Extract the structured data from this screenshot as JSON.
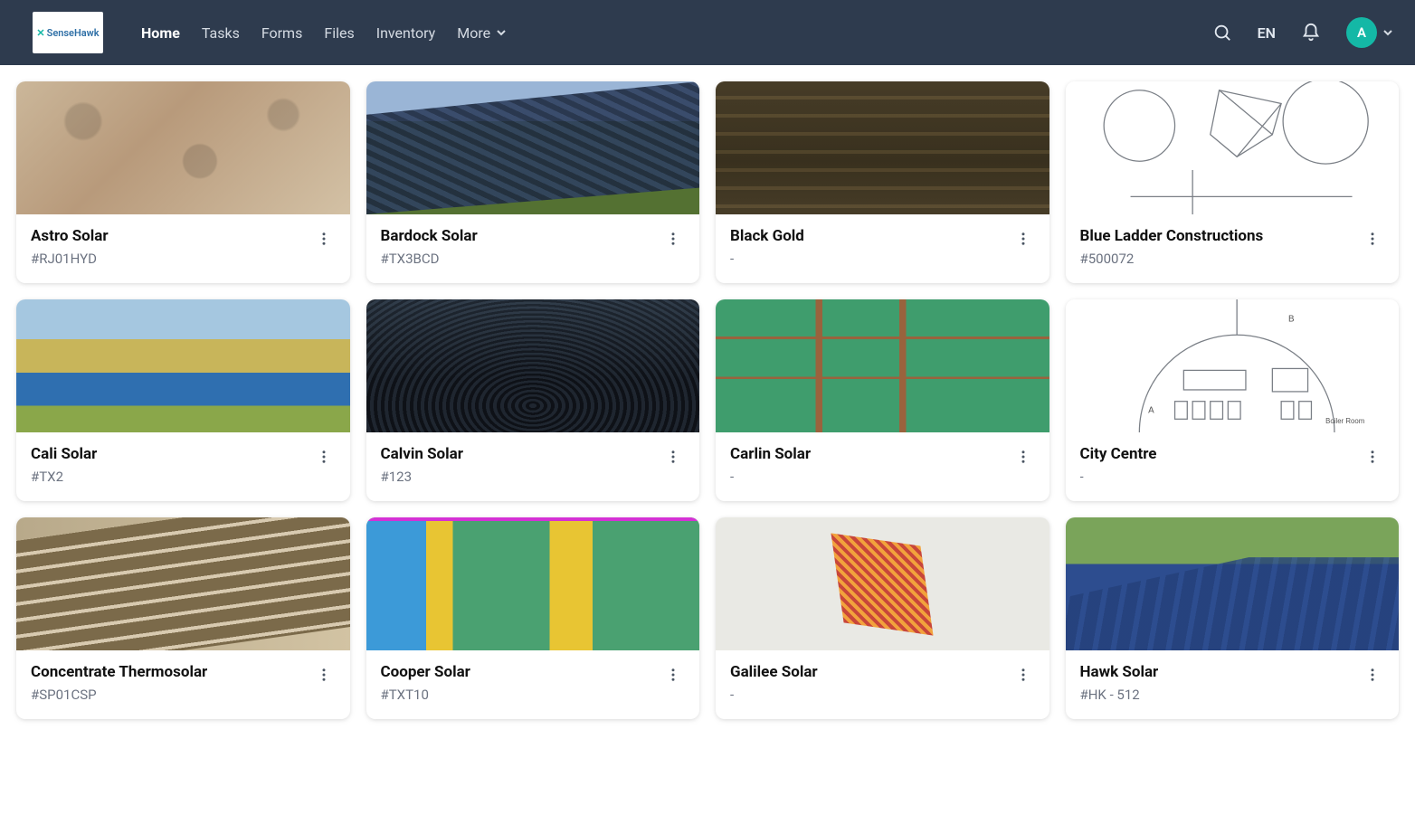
{
  "brand": {
    "name": "SenseHawk"
  },
  "nav": {
    "items": [
      {
        "label": "Home",
        "active": true
      },
      {
        "label": "Tasks",
        "active": false
      },
      {
        "label": "Forms",
        "active": false
      },
      {
        "label": "Files",
        "active": false
      },
      {
        "label": "Inventory",
        "active": false
      },
      {
        "label": "More",
        "active": false,
        "has_chevron": true
      }
    ]
  },
  "header": {
    "language": "EN",
    "avatar_initial": "A"
  },
  "cards": [
    {
      "title": "Astro Solar",
      "sub": "#RJ01HYD",
      "thumb_style": "t0"
    },
    {
      "title": "Bardock Solar",
      "sub": "#TX3BCD",
      "thumb_style": "t1"
    },
    {
      "title": "Black Gold",
      "sub": "-",
      "thumb_style": "t2"
    },
    {
      "title": "Blue Ladder Constructions",
      "sub": "#500072",
      "thumb_style": "t3"
    },
    {
      "title": "Cali Solar",
      "sub": "#TX2",
      "thumb_style": "t4"
    },
    {
      "title": "Calvin Solar",
      "sub": "#123",
      "thumb_style": "t5"
    },
    {
      "title": "Carlin Solar",
      "sub": "-",
      "thumb_style": "t6"
    },
    {
      "title": "City Centre",
      "sub": "-",
      "thumb_style": "t7"
    },
    {
      "title": "Concentrate Thermosolar",
      "sub": "#SP01CSP",
      "thumb_style": "t8"
    },
    {
      "title": "Cooper Solar",
      "sub": "#TXT10",
      "thumb_style": "t9"
    },
    {
      "title": "Galilee Solar",
      "sub": "-",
      "thumb_style": "t10"
    },
    {
      "title": "Hawk Solar",
      "sub": "#HK - 512",
      "thumb_style": "t11"
    }
  ]
}
